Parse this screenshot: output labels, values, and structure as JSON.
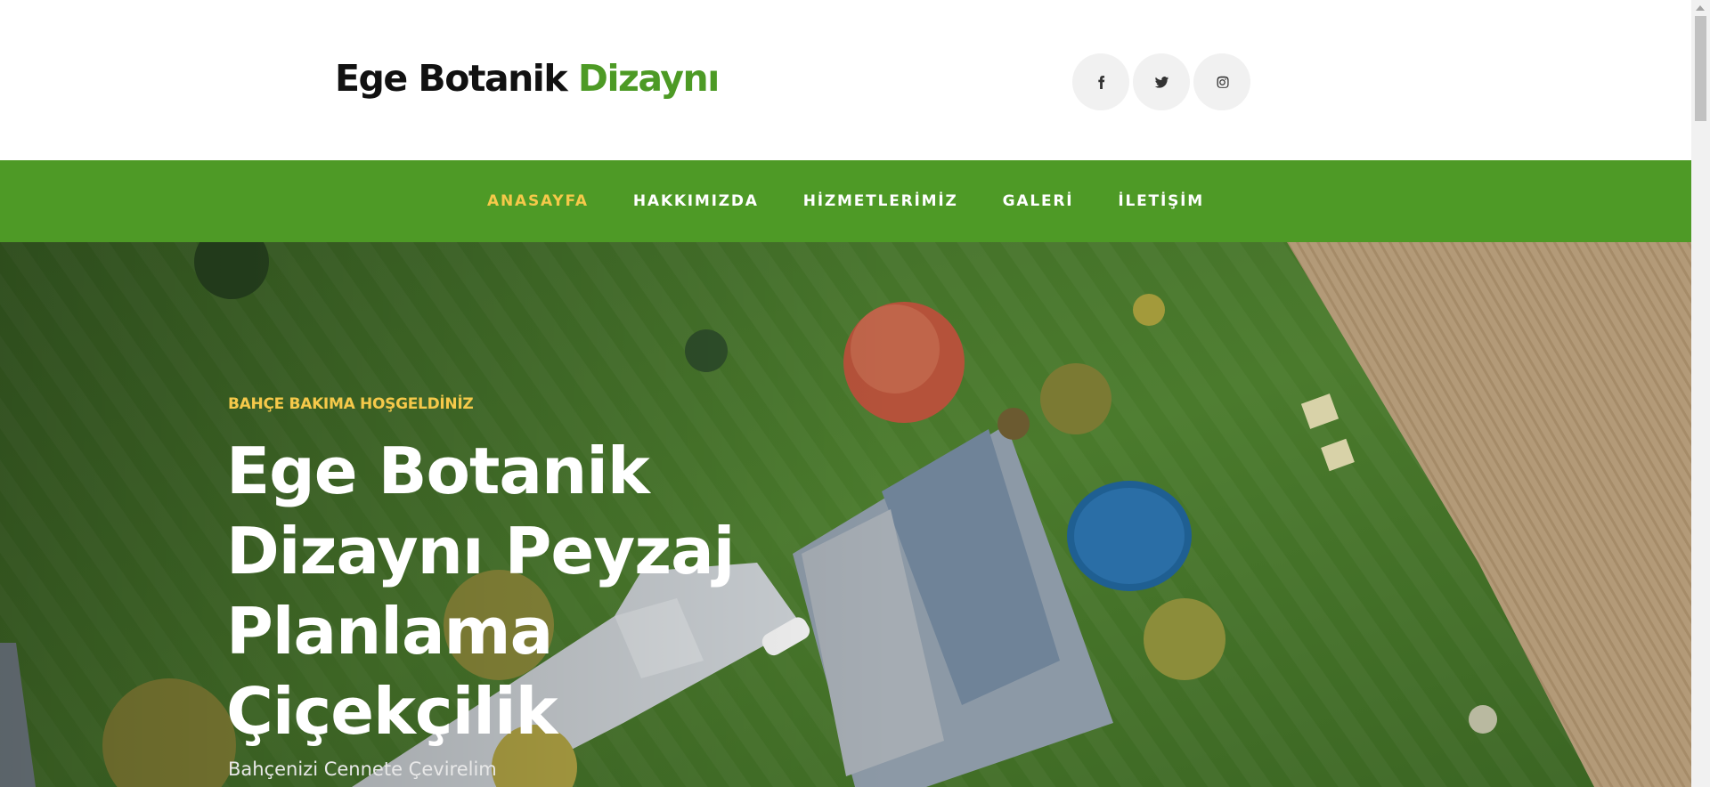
{
  "header": {
    "logo_part1": "Ege Botanik",
    "logo_part2": "Dizaynı",
    "social": [
      {
        "icon": "facebook-icon"
      },
      {
        "icon": "twitter-icon"
      },
      {
        "icon": "instagram-icon"
      }
    ]
  },
  "nav": {
    "items": [
      {
        "label": "ANASAYFA",
        "active": true
      },
      {
        "label": "HAKKIMIZDA",
        "active": false
      },
      {
        "label": "HİZMETLERİMİZ",
        "active": false
      },
      {
        "label": "GALERİ",
        "active": false
      },
      {
        "label": "İLETİŞİM",
        "active": false
      }
    ]
  },
  "hero": {
    "eyebrow": "BAHÇE BAKIMA HOŞGELDİNİZ",
    "headline": "Ege Botanik Dizaynı Peyzaj Planlama Çiçekçilik",
    "subtitle": "Bahçenizi Cennete Çevirelim"
  },
  "colors": {
    "brand_green": "#4e9a26",
    "accent_yellow": "#f6c94a",
    "logo_dark": "#111111"
  }
}
